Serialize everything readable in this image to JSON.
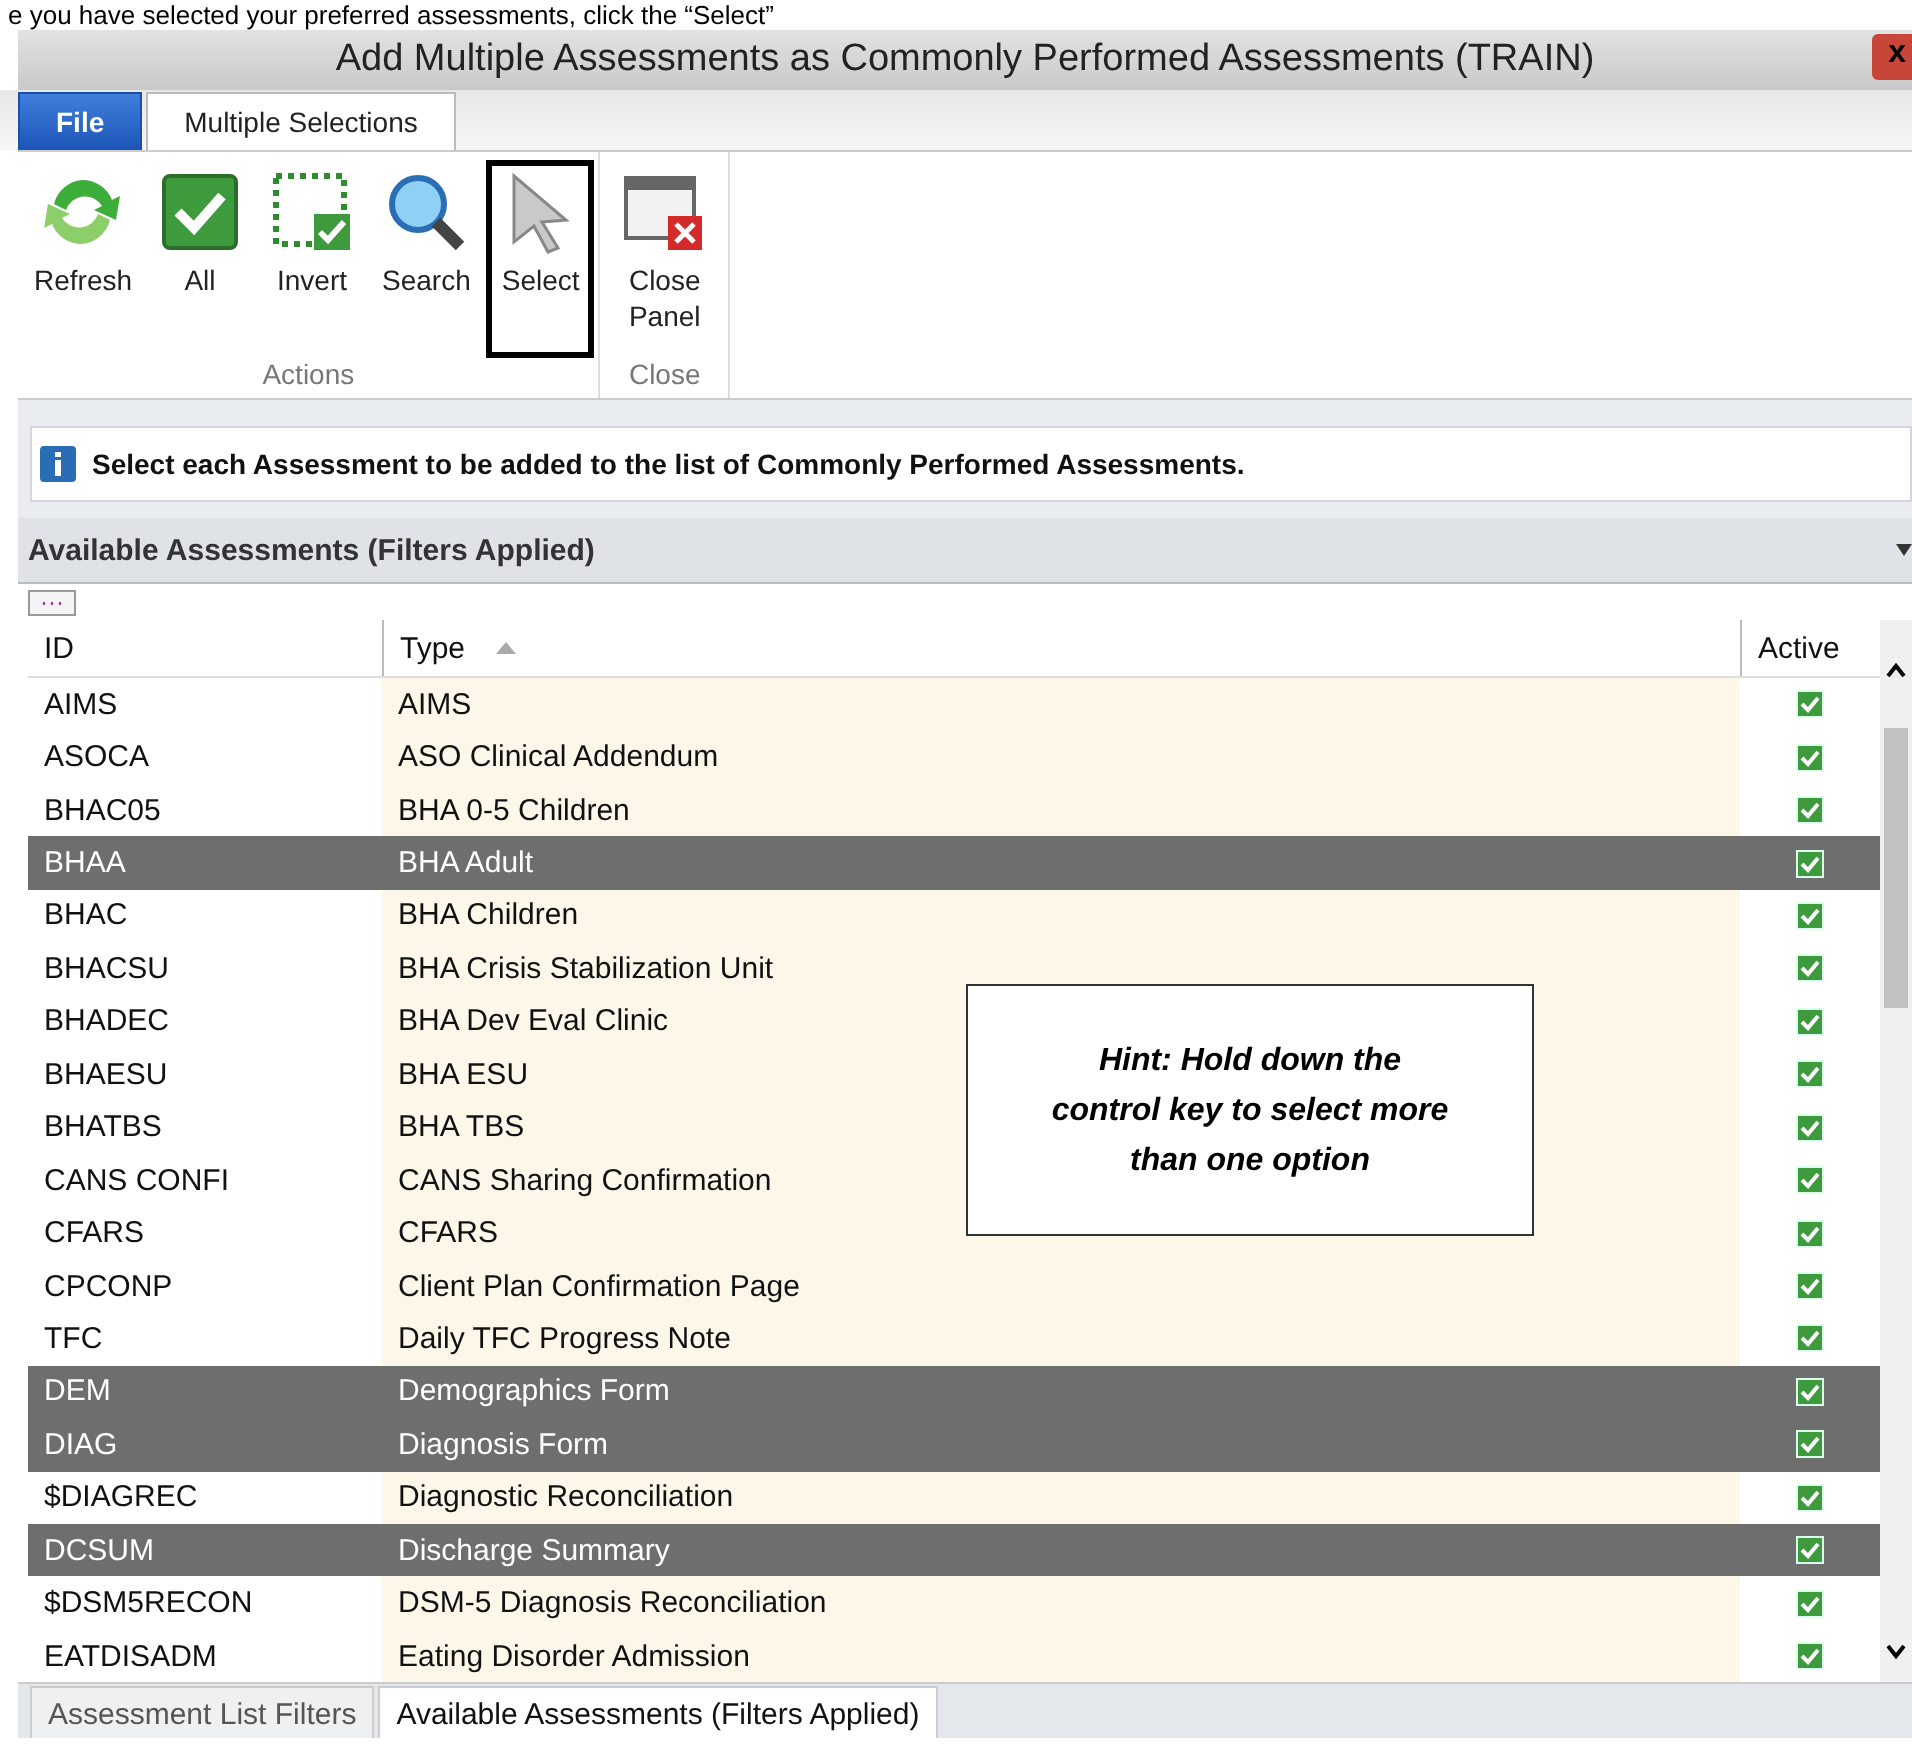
{
  "caption": "e you have selected your preferred assessments, click the “Select”",
  "window": {
    "title": "Add Multiple Assessments as Commonly Performed Assessments (TRAIN)",
    "close": "x"
  },
  "ribbon": {
    "tabs": [
      {
        "label": "File",
        "kind": "file",
        "selected": false
      },
      {
        "label": "Multiple Selections",
        "kind": "page",
        "selected": true
      }
    ],
    "groups": [
      {
        "label": "Actions",
        "buttons": [
          {
            "label": "Refresh",
            "kind": "refresh",
            "outlined": false
          },
          {
            "label": "All",
            "kind": "all",
            "outlined": false
          },
          {
            "label": "Invert",
            "kind": "invert",
            "outlined": false
          },
          {
            "label": "Search",
            "kind": "search",
            "outlined": false
          },
          {
            "label": "Select",
            "kind": "select",
            "outlined": true
          }
        ]
      },
      {
        "label": "Close",
        "buttons": [
          {
            "label": "Close Panel",
            "kind": "close",
            "outlined": false
          }
        ]
      }
    ]
  },
  "info": "Select each Assessment to be added to the list of Commonly Performed Assessments.",
  "panel": {
    "title": "Available Assessments (Filters Applied)",
    "more": "···"
  },
  "table": {
    "columns": [
      {
        "label": "ID",
        "sorted": false
      },
      {
        "label": "Type",
        "sorted": true
      },
      {
        "label": "Active",
        "sorted": false
      }
    ],
    "rows": [
      {
        "id": "AIMS",
        "type": "AIMS",
        "active": true,
        "selected": false
      },
      {
        "id": "ASOCA",
        "type": "ASO Clinical Addendum",
        "active": true,
        "selected": false
      },
      {
        "id": "BHAC05",
        "type": "BHA 0-5 Children",
        "active": true,
        "selected": false
      },
      {
        "id": "BHAA",
        "type": "BHA Adult",
        "active": true,
        "selected": true
      },
      {
        "id": "BHAC",
        "type": "BHA Children",
        "active": true,
        "selected": false
      },
      {
        "id": "BHACSU",
        "type": "BHA Crisis Stabilization Unit",
        "active": true,
        "selected": false
      },
      {
        "id": "BHADEC",
        "type": "BHA Dev Eval Clinic",
        "active": true,
        "selected": false
      },
      {
        "id": "BHAESU",
        "type": "BHA ESU",
        "active": true,
        "selected": false
      },
      {
        "id": "BHATBS",
        "type": "BHA TBS",
        "active": true,
        "selected": false
      },
      {
        "id": "CANS CONFI",
        "type": "CANS Sharing Confirmation",
        "active": true,
        "selected": false
      },
      {
        "id": "CFARS",
        "type": "CFARS",
        "active": true,
        "selected": false
      },
      {
        "id": "CPCONP",
        "type": "Client Plan Confirmation Page",
        "active": true,
        "selected": false
      },
      {
        "id": "TFC",
        "type": "Daily TFC Progress Note",
        "active": true,
        "selected": false
      },
      {
        "id": "DEM",
        "type": "Demographics Form",
        "active": true,
        "selected": true
      },
      {
        "id": "DIAG",
        "type": "Diagnosis Form",
        "active": true,
        "selected": true
      },
      {
        "id": "$DIAGREC",
        "type": "Diagnostic Reconciliation",
        "active": true,
        "selected": false
      },
      {
        "id": "DCSUM",
        "type": "Discharge Summary",
        "active": true,
        "selected": true
      },
      {
        "id": "$DSM5RECON",
        "type": "DSM-5 Diagnosis Reconciliation",
        "active": true,
        "selected": false
      },
      {
        "id": "EATDISADM",
        "type": "Eating Disorder Admission",
        "active": true,
        "selected": false
      }
    ]
  },
  "hint": "Hint: Hold down the control key to select more than one option",
  "bottom_tabs": [
    {
      "label": "Assessment List Filters",
      "selected": false
    },
    {
      "label": "Available Assessments (Filters Applied)",
      "selected": true
    }
  ]
}
